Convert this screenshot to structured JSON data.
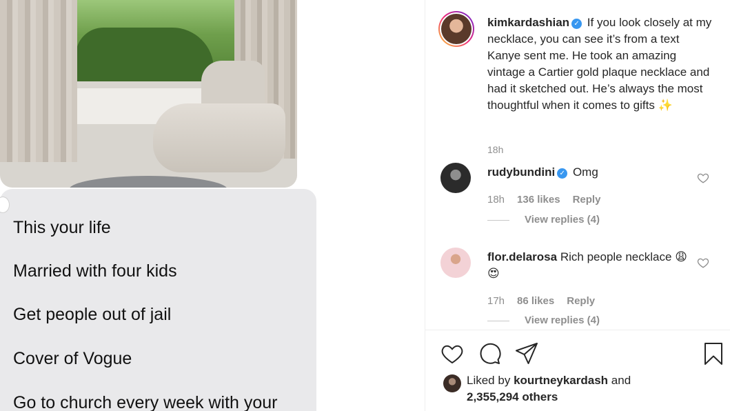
{
  "photo": {
    "message_lines": [
      "This your life",
      "Married with four kids",
      "Get people out of jail",
      "Cover of Vogue",
      "Go to church every week with your"
    ]
  },
  "post": {
    "author": "kimkardashian",
    "caption": "If you look closely at my necklace, you can see it’s from a text Kanye sent me. He took an amazing vintage a Cartier gold plaque necklace and had it sketched out. He’s always the most thoughtful when it comes to gifts",
    "caption_emoji": "✨",
    "time": "18h"
  },
  "comments": [
    {
      "username": "rudybundini",
      "verified": true,
      "text": "Omg",
      "time": "18h",
      "likes": "136 likes",
      "reply": "Reply",
      "view_replies": "View replies (4)"
    },
    {
      "username": "flor.delarosa",
      "verified": false,
      "text": "Rich people necklace",
      "emojis": "😩😍",
      "time": "17h",
      "likes": "86 likes",
      "reply": "Reply",
      "view_replies": "View replies (4)"
    }
  ],
  "footer": {
    "liked_by_prefix": "Liked by",
    "liked_by_user": "kourtneykardash",
    "liked_by_and": "and",
    "others": "2,355,294 others"
  },
  "icons": {
    "like": "heart-icon",
    "comment": "comment-icon",
    "share": "paper-plane-icon",
    "save": "bookmark-icon"
  },
  "colors": {
    "verified": "#3897f0",
    "muted": "#8e8e8e",
    "text": "#262626"
  }
}
